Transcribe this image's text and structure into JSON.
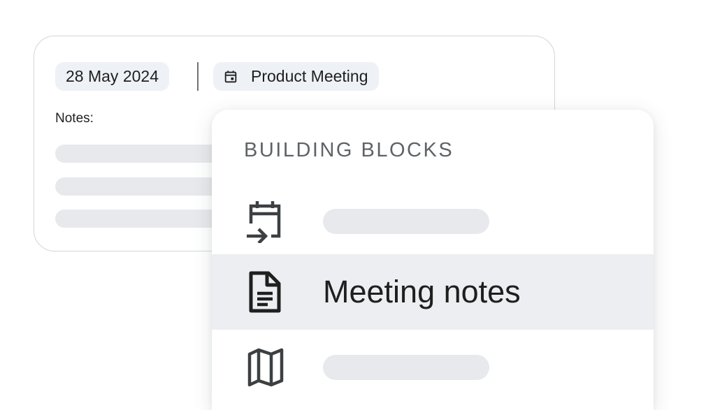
{
  "document_card": {
    "date_chip": "28 May 2024",
    "event_chip": {
      "icon": "calendar-event-icon",
      "label": "Product Meeting"
    },
    "notes_label": "Notes:"
  },
  "building_blocks_menu": {
    "heading": "BUILDING BLOCKS",
    "items": [
      {
        "icon": "calendar-import-icon",
        "label": ""
      },
      {
        "icon": "document-icon",
        "label": "Meeting notes",
        "highlighted": true
      },
      {
        "icon": "map-icon",
        "label": ""
      }
    ]
  },
  "colors": {
    "chip_background": "#eef1f6",
    "placeholder_bar": "#e8e9ec",
    "highlight_row": "#eceef1",
    "heading_text": "#5f6368",
    "primary_text": "#1f1f1f"
  }
}
